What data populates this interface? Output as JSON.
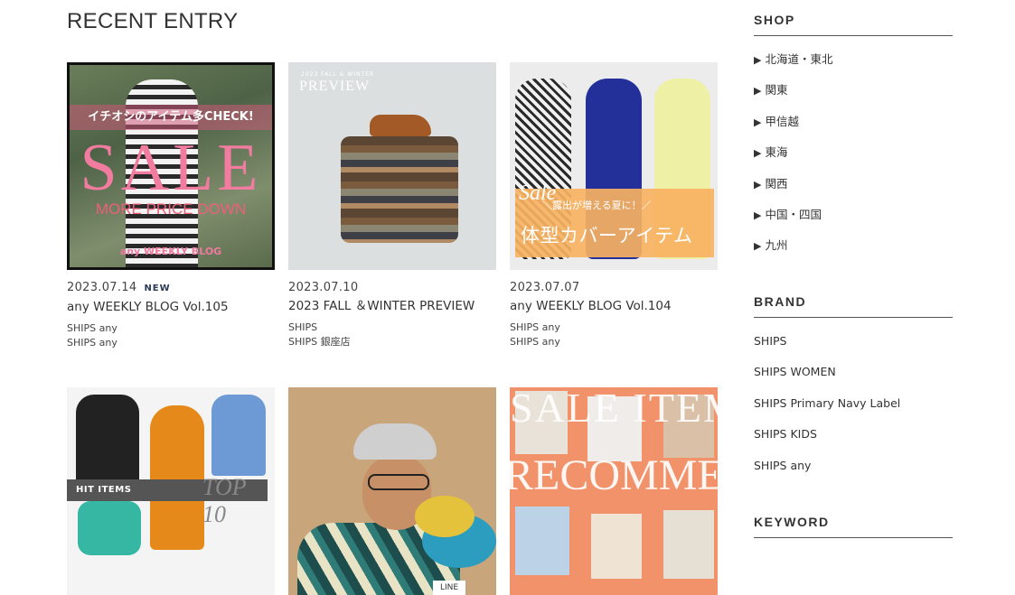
{
  "page_title": "RECENT ENTRY",
  "entries": [
    {
      "date": "2023.07.14",
      "badge": "NEW",
      "title": "any WEEKLY BLOG Vol.105",
      "tags": [
        "SHIPS any",
        "SHIPS any"
      ],
      "image": {
        "band": "イチオシのアイテム多CHECK!",
        "big": "SALE",
        "sub": "MORE PRICE DOWN",
        "foot": "any WEEKLY BLOG"
      }
    },
    {
      "date": "2023.07.10",
      "badge": "",
      "title": "2023 FALL ＆WINTER PREVIEW",
      "tags": [
        "SHIPS",
        "SHIPS 銀座店"
      ],
      "image": {
        "kicker": "2023 FALL & WINTER",
        "head": "PREVIEW"
      }
    },
    {
      "date": "2023.07.07",
      "badge": "",
      "title": "any WEEKLY BLOG Vol.104",
      "tags": [
        "SHIPS any",
        "SHIPS any"
      ],
      "image": {
        "script": "Sale",
        "small": "＼露出が増える夏に！／",
        "big": "体型カバーアイテム"
      }
    },
    {
      "image": {
        "label": "HIT ITEMS",
        "top": "TOP 10"
      }
    },
    {
      "image": {
        "tag": "LINE"
      }
    },
    {
      "image": {
        "line1": "SALE ITEM",
        "line2": "RECOMMEND"
      }
    }
  ],
  "sidebar": {
    "shop": {
      "heading": "SHOP",
      "items": [
        "北海道・東北",
        "関東",
        "甲信越",
        "東海",
        "関西",
        "中国・四国",
        "九州"
      ]
    },
    "brand": {
      "heading": "BRAND",
      "items": [
        "SHIPS",
        "SHIPS WOMEN",
        "SHIPS Primary Navy Label",
        "SHIPS KIDS",
        "SHIPS any"
      ]
    },
    "keyword": {
      "heading": "KEYWORD"
    }
  },
  "colors": {
    "accent_badge": "#2b3b57",
    "text": "#333333",
    "rule": "#555555"
  },
  "icons": {
    "list_arrow": "▶"
  }
}
